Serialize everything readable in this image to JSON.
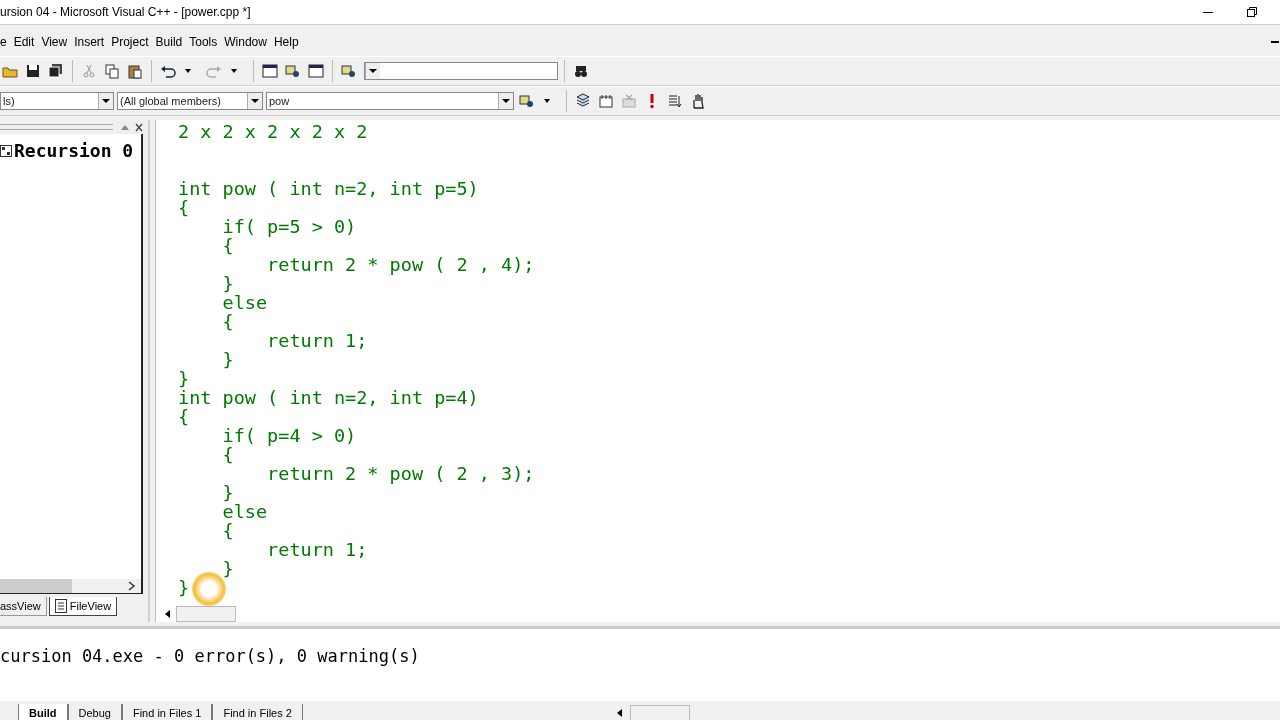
{
  "window": {
    "title": "ursion 04 - Microsoft Visual C++ - [power.cpp *]"
  },
  "menu": [
    "e",
    "Edit",
    "View",
    "Insert",
    "Project",
    "Build",
    "Tools",
    "Window",
    "Help"
  ],
  "wizard_bar": {
    "class_field": "ls)",
    "filter_field": "(All global members)",
    "member_field": "pow"
  },
  "workspace": {
    "root": "Recursion 0",
    "tabs": [
      {
        "label": "assView",
        "selected": false
      },
      {
        "label": "FileView",
        "selected": true
      }
    ]
  },
  "editor": {
    "note": "2 x 2 x 2 x 2 x 2",
    "lines": [
      "int pow ( int n=2, int p=5)",
      "{",
      "    if( p=5 > 0)",
      "    {",
      "        return 2 * pow ( 2 , 4);",
      "    }",
      "    else",
      "    {",
      "        return 1;",
      "    }",
      "}",
      "int pow ( int n=2, int p=4)",
      "{",
      "    if( p=4 > 0)",
      "    {",
      "        return 2 * pow ( 2 , 3);",
      "    }",
      "    else",
      "    {",
      "        return 1;",
      "    }",
      "}"
    ]
  },
  "output": {
    "text": "cursion 04.exe - 0 error(s), 0 warning(s)",
    "tabs": [
      {
        "label": "Build",
        "selected": true
      },
      {
        "label": "Debug",
        "selected": false
      },
      {
        "label": "Find in Files 1",
        "selected": false
      },
      {
        "label": "Find in Files 2",
        "selected": false
      }
    ]
  }
}
